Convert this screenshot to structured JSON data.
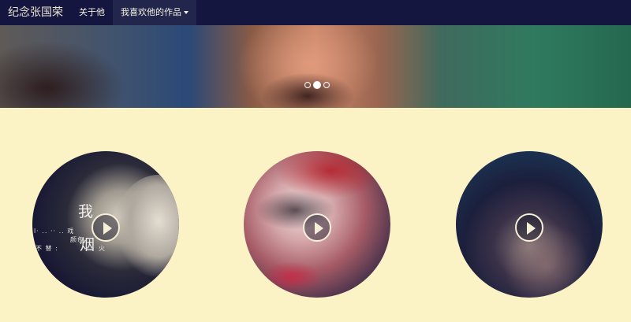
{
  "navbar": {
    "brand": "纪念张国荣",
    "items": [
      {
        "label": "关于他"
      },
      {
        "label": "我喜欢他的作品"
      }
    ]
  },
  "hero": {
    "slides": 3,
    "active_slide": 2
  },
  "works": [
    {
      "caption_lines": [
        "我",
        "烟"
      ],
      "caption_small": [
        "l· ..  ·· ..  戏",
        "颜色",
        "不  替 :",
        "火"
      ]
    },
    {},
    {}
  ],
  "colors": {
    "navbar_bg": "#14163f",
    "page_bg": "#fbf2c6",
    "play_icon": "#f6efd8"
  }
}
